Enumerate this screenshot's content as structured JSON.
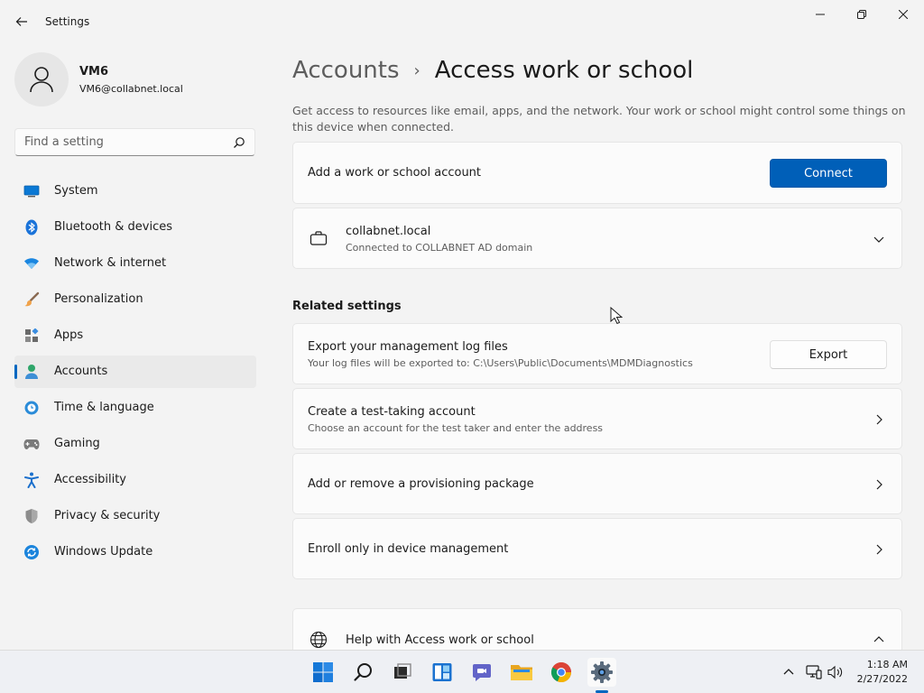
{
  "window": {
    "title": "Settings"
  },
  "profile": {
    "name": "VM6",
    "email": "VM6@collabnet.local"
  },
  "search": {
    "placeholder": "Find a setting"
  },
  "nav": {
    "items": [
      {
        "label": "System",
        "icon": "monitor-icon"
      },
      {
        "label": "Bluetooth & devices",
        "icon": "bluetooth-icon"
      },
      {
        "label": "Network & internet",
        "icon": "wifi-icon"
      },
      {
        "label": "Personalization",
        "icon": "brush-icon"
      },
      {
        "label": "Apps",
        "icon": "apps-icon"
      },
      {
        "label": "Accounts",
        "icon": "person-icon",
        "active": true
      },
      {
        "label": "Time & language",
        "icon": "globe-clock-icon"
      },
      {
        "label": "Gaming",
        "icon": "gamepad-icon"
      },
      {
        "label": "Accessibility",
        "icon": "accessibility-icon"
      },
      {
        "label": "Privacy & security",
        "icon": "shield-icon"
      },
      {
        "label": "Windows Update",
        "icon": "update-icon"
      }
    ]
  },
  "breadcrumb": {
    "parent": "Accounts",
    "separator": "›",
    "current": "Access work or school"
  },
  "main": {
    "description": "Get access to resources like email, apps, and the network. Your work or school might control some things on this device when connected.",
    "add_account": {
      "title": "Add a work or school account",
      "button": "Connect"
    },
    "connected_account": {
      "title": "collabnet.local",
      "subtitle": "Connected to COLLABNET AD domain"
    },
    "related_title": "Related settings",
    "export": {
      "title": "Export your management log files",
      "subtitle": "Your log files will be exported to: C:\\Users\\Public\\Documents\\MDMDiagnostics",
      "button": "Export"
    },
    "test_account": {
      "title": "Create a test-taking account",
      "subtitle": "Choose an account for the test taker and enter the address"
    },
    "provisioning": {
      "title": "Add or remove a provisioning package"
    },
    "enroll": {
      "title": "Enroll only in device management"
    },
    "help": {
      "title": "Help with Access work or school"
    }
  },
  "taskbar": {
    "apps": [
      "start-icon",
      "search-icon",
      "task-view-icon",
      "widgets-icon",
      "chat-icon",
      "file-explorer-icon",
      "chrome-icon",
      "settings-icon"
    ],
    "time": "1:18 AM",
    "date": "2/27/2022"
  },
  "colors": {
    "accent": "#005fb8",
    "background": "#f3f3f3",
    "card": "#fbfbfb"
  }
}
